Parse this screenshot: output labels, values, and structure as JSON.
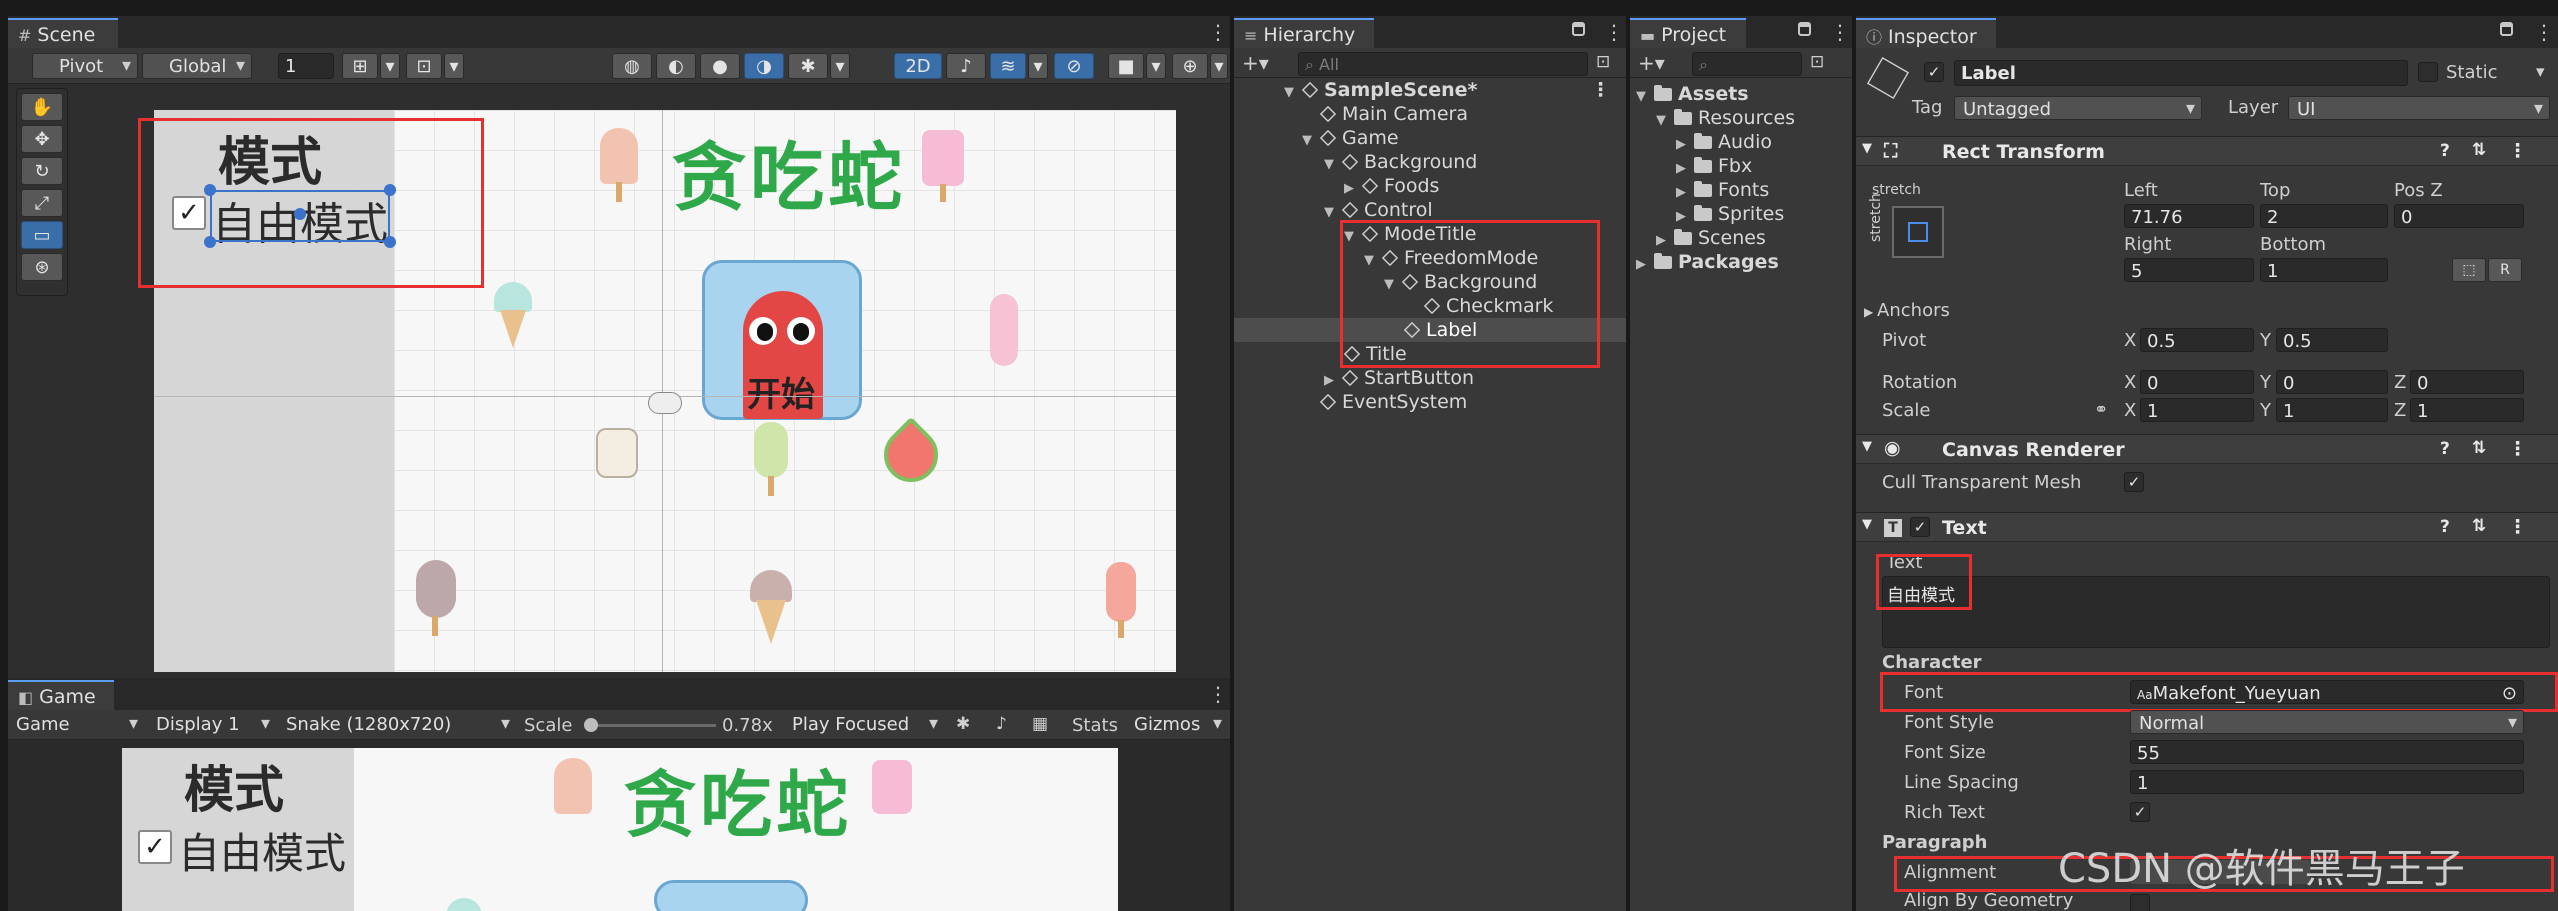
{
  "scene_tab": {
    "label": "Scene"
  },
  "scene_toolbar": {
    "pivot": "Pivot",
    "global": "Global",
    "grid_value": "1",
    "mode_2d": "2D"
  },
  "scene_view": {
    "mode_label": "模式",
    "checkbox_label": "自由模式",
    "game_title": "贪吃蛇",
    "start_label": "开始"
  },
  "game_tab": {
    "label": "Game"
  },
  "game_toolbar": {
    "game_dropdown": "Game",
    "display": "Display 1",
    "resolution": "Snake (1280x720)",
    "scale_label": "Scale",
    "scale_value": "0.78x",
    "play_mode": "Play Focused",
    "stats": "Stats",
    "gizmos": "Gizmos"
  },
  "game_view": {
    "mode_label": "模式",
    "checkbox_label": "自由模式",
    "game_title": "贪吃蛇"
  },
  "hierarchy": {
    "tab_label": "Hierarchy",
    "search_placeholder": "All",
    "items": [
      {
        "label": "SampleScene*"
      },
      {
        "label": "Main Camera"
      },
      {
        "label": "Game"
      },
      {
        "label": "Background"
      },
      {
        "label": "Foods"
      },
      {
        "label": "Control"
      },
      {
        "label": "ModeTitle"
      },
      {
        "label": "FreedomMode"
      },
      {
        "label": "Background"
      },
      {
        "label": "Checkmark"
      },
      {
        "label": "Label"
      },
      {
        "label": "Title"
      },
      {
        "label": "StartButton"
      },
      {
        "label": "EventSystem"
      }
    ]
  },
  "project": {
    "tab_label": "Project",
    "items": [
      {
        "label": "Assets"
      },
      {
        "label": "Resources"
      },
      {
        "label": "Audio"
      },
      {
        "label": "Fbx"
      },
      {
        "label": "Fonts"
      },
      {
        "label": "Sprites"
      },
      {
        "label": "Scenes"
      },
      {
        "label": "Packages"
      }
    ]
  },
  "inspector": {
    "tab_label": "Inspector",
    "object_name": "Label",
    "static_label": "Static",
    "tag_label": "Tag",
    "tag_value": "Untagged",
    "layer_label": "Layer",
    "layer_value": "UI",
    "rect_transform": {
      "title": "Rect Transform",
      "anchor_preset": "stretch",
      "left_label": "Left",
      "left_value": "71.76",
      "top_label": "Top",
      "top_value": "2",
      "posz_label": "Pos Z",
      "posz_value": "0",
      "right_label": "Right",
      "right_value": "5",
      "bottom_label": "Bottom",
      "bottom_value": "1",
      "r_button": "R",
      "anchors_label": "Anchors",
      "pivot_label": "Pivot",
      "pivot_x": "0.5",
      "pivot_y": "0.5",
      "rotation_label": "Rotation",
      "rot_x": "0",
      "rot_y": "0",
      "rot_z": "0",
      "scale_label": "Scale",
      "scale_x": "1",
      "scale_y": "1",
      "scale_z": "1",
      "x": "X",
      "y": "Y",
      "z": "Z"
    },
    "canvas_renderer": {
      "title": "Canvas Renderer",
      "cull_label": "Cull Transparent Mesh"
    },
    "text_component": {
      "title": "Text",
      "text_label": "Text",
      "text_value": "自由模式",
      "character_label": "Character",
      "font_label": "Font",
      "font_value": "Makefont_Yueyuan",
      "font_style_label": "Font Style",
      "font_style_value": "Normal",
      "font_size_label": "Font Size",
      "font_size_value": "55",
      "line_spacing_label": "Line Spacing",
      "line_spacing_value": "1",
      "rich_text_label": "Rich Text",
      "paragraph_label": "Paragraph",
      "alignment_label": "Alignment",
      "align_geom_label": "Align By Geometry"
    }
  },
  "watermark": "CSDN @软件黑马王子",
  "colors": {
    "accent": "#5a9cff",
    "highlight": "#e5302f",
    "title_green": "#2fa84a",
    "game_bg": "#f7f7f7",
    "start_bg": "#e34745"
  }
}
